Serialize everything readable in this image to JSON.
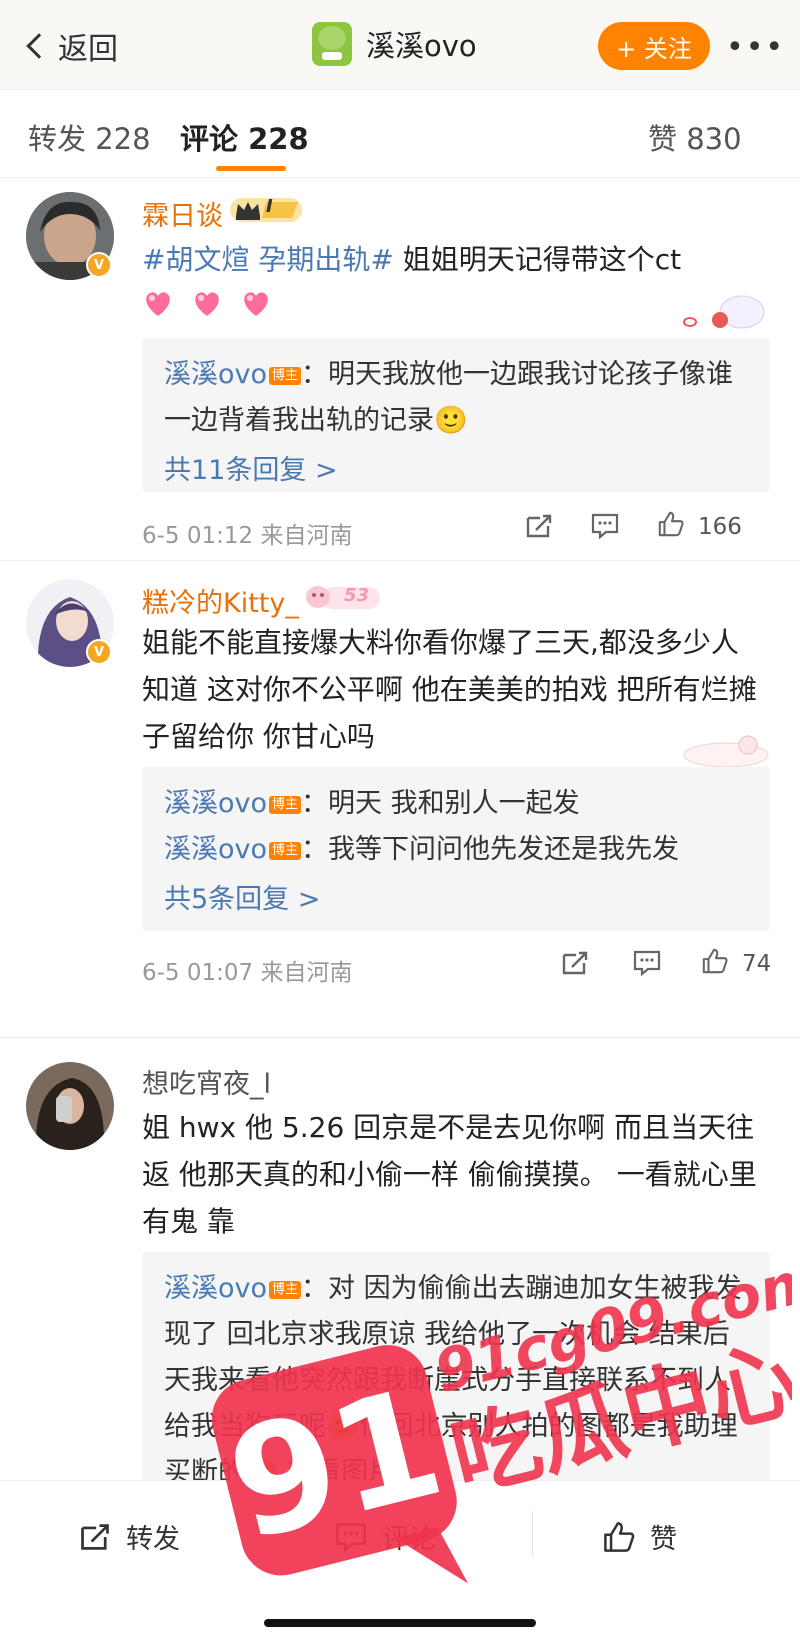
{
  "header": {
    "back_label": "返回",
    "title": "溪溪ovo",
    "follow_label": "+ 关注",
    "more_label": "•••"
  },
  "tabs": {
    "repost": "转发 228",
    "comment": "评论 228",
    "like": "赞 830"
  },
  "comments": [
    {
      "name": "霖日谈",
      "level_badge": "I",
      "topic": "#胡文煊 孕期出轨#",
      "text": " 姐姐明天记得带这个ct",
      "replies": [
        {
          "user": "溪溪ovo",
          "tag": "博主",
          "text": "：明天我放他一边跟我讨论孩子像谁一边背着我出轨的记录🙂"
        }
      ],
      "more_replies": "共11条回复 >",
      "meta": "6-5 01:12  来自河南",
      "likes": "166"
    },
    {
      "name": "糕冷的Kitty_",
      "level_badge": "53",
      "text": "姐能不能直接爆大料你看你爆了三天,都没多少人知道 这对你不公平啊 他在美美的拍戏 把所有烂摊子留给你 你甘心吗",
      "replies": [
        {
          "user": "溪溪ovo",
          "tag": "博主",
          "text": "：明天 我和别人一起发"
        },
        {
          "user": "溪溪ovo",
          "tag": "博主",
          "text": "：我等下问问他先发还是我先发"
        }
      ],
      "more_replies": "共5条回复 >",
      "meta": "6-5 01:07  来自河南",
      "likes": "74"
    },
    {
      "name": "想吃宵夜_l",
      "text": "姐 hwx 他 5.26 回京是不是去见你啊 而且当天往返  他那天真的和小偷一样 偷偷摸摸。 一看就心里有鬼 靠",
      "replies": [
        {
          "user": "溪溪ovo",
          "tag": "博主",
          "text": "：对 因为偷偷出去蹦迪加女生被我发现了 回北京求我原谅 我给他了一次机会 结果后天我来看他突然跟我断崖式分手直接联系不到人 给我当狗玩呢🙂他回北京别人拍的图都是我助理买断的🙂 查看图片"
        }
      ]
    }
  ],
  "bottom_bar": {
    "repost": "转发",
    "comment": "评论",
    "like": "赞"
  },
  "watermark": {
    "number": "91",
    "site": "91cg09.com",
    "slogan": "吃瓜中心"
  },
  "colors": {
    "accent": "#ff8200",
    "link": "#4a79b3",
    "username_orange": "#e8710a",
    "watermark": "#f0344e"
  }
}
